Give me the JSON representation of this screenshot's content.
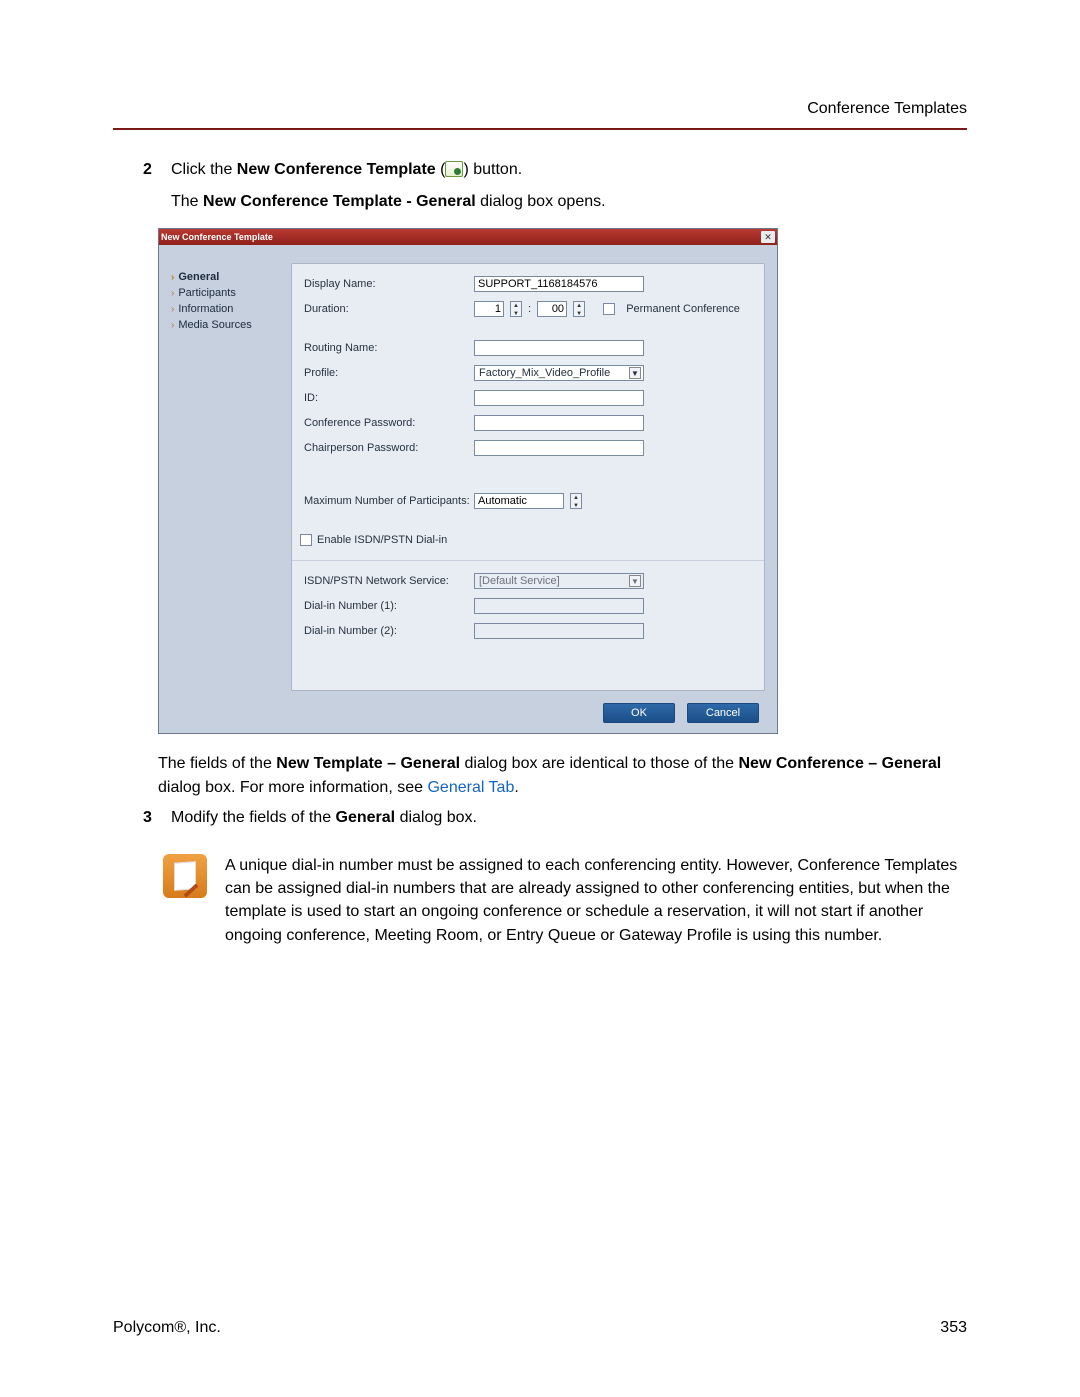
{
  "header": {
    "section_title": "Conference Templates"
  },
  "steps": {
    "s2": {
      "num": "2",
      "prefix": "Click the ",
      "bold": "New Conference Template",
      "open_paren": " (",
      "close_paren": ") button.",
      "sub_prefix": "The ",
      "sub_bold": "New Conference Template - General",
      "sub_suffix": " dialog box opens."
    },
    "s3": {
      "num": "3",
      "prefix": "Modify the fields of the ",
      "bold": "General",
      "suffix": " dialog box."
    }
  },
  "dialog": {
    "title": "New Conference Template",
    "nav": {
      "items": [
        {
          "label": "General",
          "active": true
        },
        {
          "label": "Participants",
          "active": false
        },
        {
          "label": "Information",
          "active": false
        },
        {
          "label": "Media Sources",
          "active": false
        }
      ]
    },
    "form": {
      "display_name_label": "Display Name:",
      "display_name_value": "SUPPORT_1168184576",
      "duration_label": "Duration:",
      "duration_h": "1",
      "duration_sep": ":",
      "duration_m": "00",
      "permanent_label": "Permanent Conference",
      "routing_label": "Routing Name:",
      "profile_label": "Profile:",
      "profile_value": "Factory_Mix_Video_Profile",
      "id_label": "ID:",
      "confpw_label": "Conference Password:",
      "chairpw_label": "Chairperson Password:",
      "maxpart_label": "Maximum Number of Participants:",
      "maxpart_value": "Automatic",
      "enable_isdn_label": "Enable ISDN/PSTN Dial-in",
      "isdn_service_label": "ISDN/PSTN Network Service:",
      "isdn_service_value": "[Default Service]",
      "dialin1_label": "Dial-in Number (1):",
      "dialin2_label": "Dial-in Number (2):"
    },
    "buttons": {
      "ok": "OK",
      "cancel": "Cancel"
    }
  },
  "follow": {
    "p1a": "The fields of the ",
    "p1b": "New Template – General",
    "p1c": " dialog box are identical to those of the ",
    "p1d": "New Conference – General",
    "p1e": " dialog box. For more information, see ",
    "p1link": "General Tab",
    "p1f": "."
  },
  "note": {
    "text": "A unique dial-in number must be assigned to each conferencing entity. However, Conference Templates can be assigned dial-in numbers that are already assigned to other conferencing entities, but when the template is used to start an ongoing conference or schedule a reservation, it will not start if another ongoing conference, Meeting Room, or Entry Queue or Gateway Profile is using this number."
  },
  "footer": {
    "company": "Polycom®, Inc.",
    "page_no": "353"
  }
}
